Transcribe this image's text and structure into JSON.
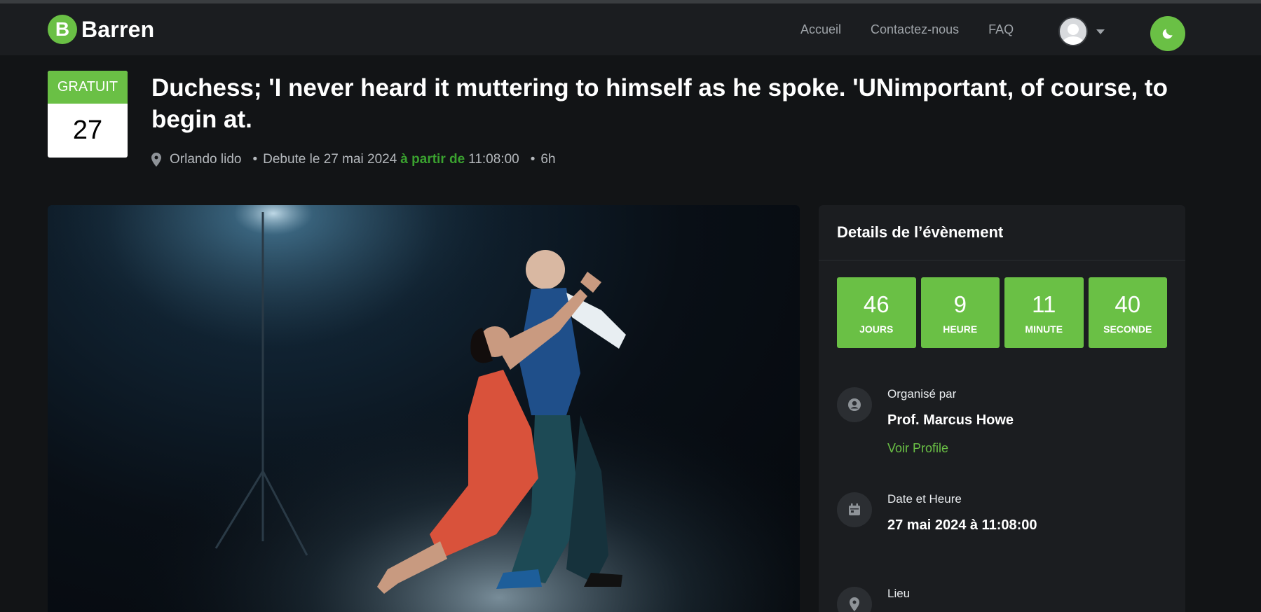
{
  "brand": {
    "logo_letter": "B",
    "name": "Barren",
    "accent": "#6ac045"
  },
  "nav": {
    "links": [
      "Accueil",
      "Contactez-nous",
      "FAQ"
    ]
  },
  "event": {
    "badge_label": "GRATUIT",
    "badge_day": "27",
    "title": "Duchess; 'I never heard it muttering to himself as he spoke. 'UNimportant, of course, to begin at.",
    "location": "Orlando lido",
    "start_prefix": "Debute le 27 mai 2024",
    "start_from": "à partir de",
    "start_time": "11:08:00",
    "duration": "6h"
  },
  "card": {
    "title": "Details de l’évènement",
    "countdown": [
      {
        "value": "46",
        "label": "JOURS"
      },
      {
        "value": "9",
        "label": "HEURE"
      },
      {
        "value": "11",
        "label": "MINUTE"
      },
      {
        "value": "40",
        "label": "SECONDE"
      }
    ],
    "organizer": {
      "label": "Organisé par",
      "name": "Prof. Marcus Howe",
      "link": "Voir Profile"
    },
    "datetime": {
      "label": "Date et Heure",
      "value": "27 mai 2024 à 11:08:00"
    },
    "venue": {
      "label": "Lieu"
    }
  },
  "icons": {
    "theme": "moon-icon",
    "user": "avatar-icon",
    "caret": "chevron-down-icon",
    "location": "map-pin-icon",
    "organizer": "user-circle-icon",
    "calendar": "calendar-icon",
    "venue": "map-pin-icon"
  }
}
